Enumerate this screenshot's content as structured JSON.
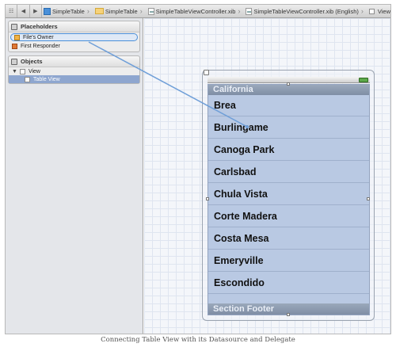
{
  "jumpbar": {
    "crumbs": [
      {
        "label": "SimpleTable",
        "icon": "project-icon"
      },
      {
        "label": "SimpleTable",
        "icon": "folder-icon"
      },
      {
        "label": "SimpleTableViewController.xib",
        "icon": "xib-file-icon"
      },
      {
        "label": "SimpleTableViewController.xib (English)",
        "icon": "xib-file-icon"
      },
      {
        "label": "View",
        "icon": "view-icon"
      }
    ]
  },
  "outline": {
    "placeholders_title": "Placeholders",
    "placeholders": [
      "File's Owner",
      "First Responder"
    ],
    "objects_title": "Objects",
    "objects": [
      "View",
      "Table View"
    ]
  },
  "tableview": {
    "header": "California",
    "rows": [
      "Brea",
      "Burlingame",
      "Canoga Park",
      "Carlsbad",
      "Chula Vista",
      "Corte Madera",
      "Costa Mesa",
      "Emeryville",
      "Escondido"
    ],
    "footer": "Section Footer"
  },
  "caption": "Connecting Table View with its Datasource and Delegate",
  "colors": {
    "selection": "#4b8fd9",
    "connection_line": "#6f9fd8",
    "table_background": "#b9c9e3"
  }
}
